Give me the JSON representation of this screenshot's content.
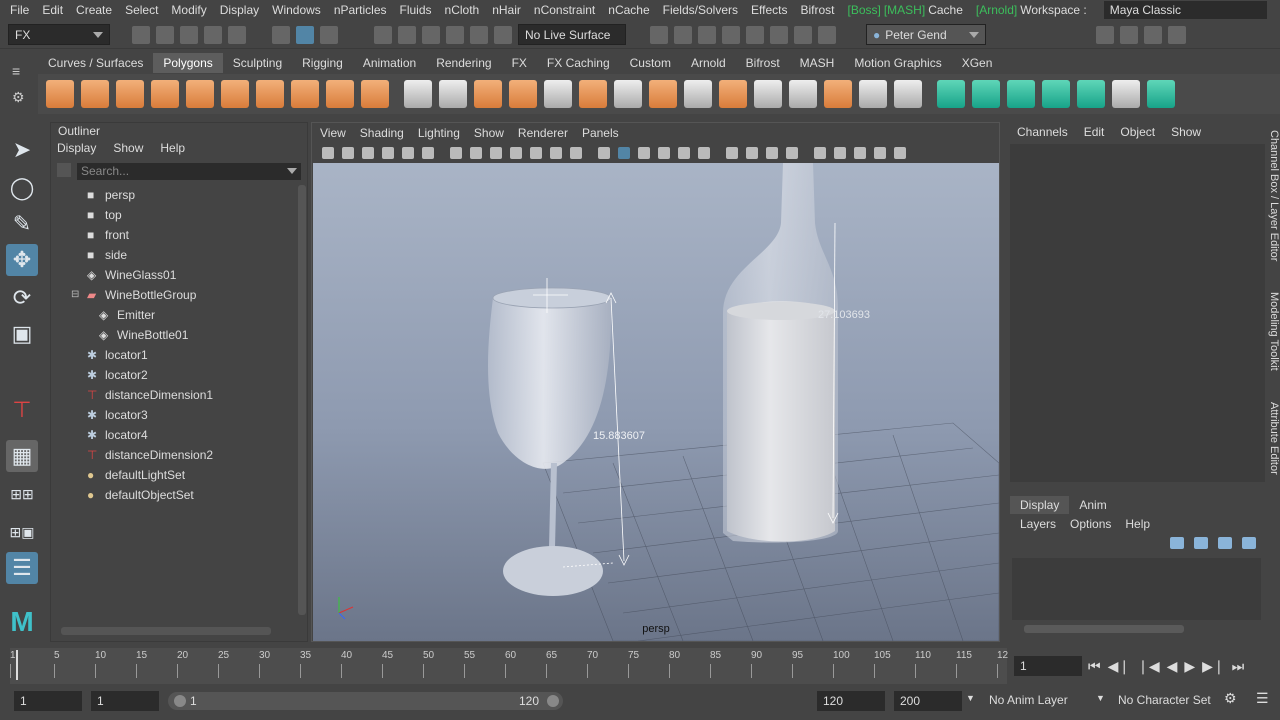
{
  "menubar": {
    "items": [
      "File",
      "Edit",
      "Create",
      "Select",
      "Modify",
      "Display",
      "Windows",
      "nParticles",
      "Fluids",
      "nCloth",
      "nHair",
      "nConstraint",
      "nCache",
      "Fields/Solvers",
      "Effects",
      "Bifrost"
    ],
    "tags": [
      "[Boss]",
      "[MASH]"
    ],
    "cache": "Cache",
    "arnold_tag": "[Arnold]",
    "workspace_label": "Workspace :",
    "workspace_value": "Maya Classic"
  },
  "status": {
    "menuset": "FX",
    "live_surface": "No Live Surface",
    "user": "Peter Gend"
  },
  "shelf": {
    "tabs": [
      "Curves / Surfaces",
      "Polygons",
      "Sculpting",
      "Rigging",
      "Animation",
      "Rendering",
      "FX",
      "FX Caching",
      "Custom",
      "Arnold",
      "Bifrost",
      "MASH",
      "Motion Graphics",
      "XGen"
    ],
    "active_tab": "Polygons"
  },
  "outliner": {
    "title": "Outliner",
    "menu": [
      "Display",
      "Show",
      "Help"
    ],
    "search_placeholder": "Search...",
    "items": [
      {
        "label": "persp",
        "icon": "camera-icon",
        "indent": 0
      },
      {
        "label": "top",
        "icon": "camera-icon",
        "indent": 0
      },
      {
        "label": "front",
        "icon": "camera-icon",
        "indent": 0
      },
      {
        "label": "side",
        "icon": "camera-icon",
        "indent": 0
      },
      {
        "label": "WineGlass01",
        "icon": "mesh-icon",
        "indent": 0
      },
      {
        "label": "WineBottleGroup",
        "icon": "group-icon",
        "indent": 0,
        "expanded": true
      },
      {
        "label": "Emitter",
        "icon": "mesh-icon",
        "indent": 1
      },
      {
        "label": "WineBottle01",
        "icon": "mesh-icon",
        "indent": 1
      },
      {
        "label": "locator1",
        "icon": "locator-icon",
        "indent": 0
      },
      {
        "label": "locator2",
        "icon": "locator-icon",
        "indent": 0
      },
      {
        "label": "distanceDimension1",
        "icon": "distance-icon",
        "indent": 0
      },
      {
        "label": "locator3",
        "icon": "locator-icon",
        "indent": 0
      },
      {
        "label": "locator4",
        "icon": "locator-icon",
        "indent": 0
      },
      {
        "label": "distanceDimension2",
        "icon": "distance-icon",
        "indent": 0
      },
      {
        "label": "defaultLightSet",
        "icon": "set-icon",
        "indent": 0
      },
      {
        "label": "defaultObjectSet",
        "icon": "set-icon",
        "indent": 0
      }
    ]
  },
  "viewport": {
    "menu": [
      "View",
      "Shading",
      "Lighting",
      "Show",
      "Renderer",
      "Panels"
    ],
    "camera": "persp",
    "dimension_glass": "15.883607",
    "dimension_bottle": "27.103693"
  },
  "channelbox": {
    "menu": [
      "Channels",
      "Edit",
      "Object",
      "Show"
    ]
  },
  "layers": {
    "tabs": [
      "Display",
      "Anim"
    ],
    "active_tab": "Display",
    "menu": [
      "Layers",
      "Options",
      "Help"
    ]
  },
  "side_tabs": [
    "Channel Box / Layer Editor",
    "Modeling Toolkit",
    "Attribute Editor"
  ],
  "timeline": {
    "ticks": [
      "1",
      "5",
      "10",
      "15",
      "20",
      "25",
      "30",
      "35",
      "40",
      "45",
      "50",
      "55",
      "60",
      "65",
      "70",
      "75",
      "80",
      "85",
      "90",
      "95",
      "100",
      "105",
      "110",
      "115",
      "12"
    ],
    "current_frame": "1"
  },
  "range": {
    "start": "1",
    "playback_start": "1",
    "slider_start": "1",
    "slider_end": "120",
    "playback_end": "120",
    "end": "200",
    "anim_layer": "No Anim Layer",
    "character_set": "No Character Set"
  },
  "colors": {
    "accent": "#5285a6",
    "green_tag": "#3cbf5c",
    "shelf_orange": "#e8995a",
    "shelf_teal": "#2fbf9f"
  }
}
